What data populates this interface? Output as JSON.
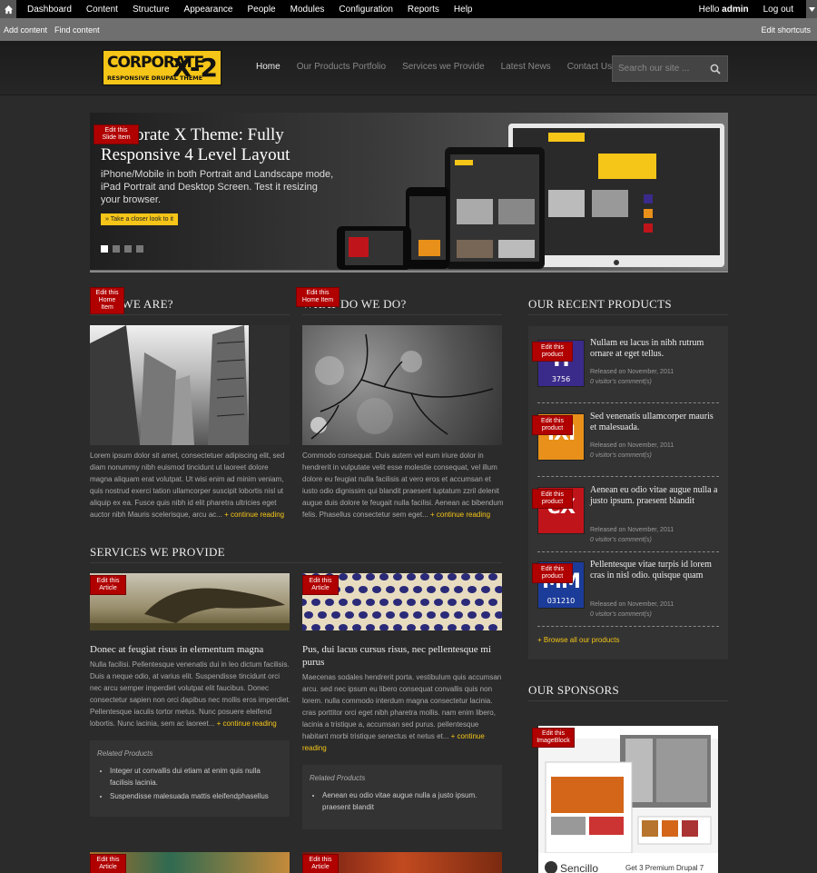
{
  "toolbar": {
    "menu": [
      "Dashboard",
      "Content",
      "Structure",
      "Appearance",
      "People",
      "Modules",
      "Configuration",
      "Reports",
      "Help"
    ],
    "hello": "Hello",
    "user": "admin",
    "logout": "Log out"
  },
  "shortcuts": {
    "items": [
      "Add content",
      "Find content"
    ],
    "edit": "Edit shortcuts"
  },
  "logo": {
    "line1": "CORPORATE",
    "line2": "RESPONSIVE DRUPAL THEME",
    "line3": "X-2"
  },
  "nav": [
    "Home",
    "Our Products Portfolio",
    "Services we Provide",
    "Latest News",
    "Contact Us"
  ],
  "search": {
    "placeholder": "Search our site ..."
  },
  "slider": {
    "edit": "Edit this Slide Item",
    "title": "Corporate X Theme: Fully Responsive 4 Level Layout",
    "text": "iPhone/Mobile in both Portrait and Landscape mode, iPad Portrait and Desktop Screen. Test it resizing your browser.",
    "button": "» Take a closer look to it",
    "slides": 4,
    "active_slide": 1
  },
  "who": {
    "edit": "Edit this Home Item",
    "title": "WHO WE ARE?",
    "text": "Lorem ipsum dolor sit amet, consectetuer adipiscing elit, sed diam nonummy nibh euismod tincidunt ut laoreet dolore magna aliquam erat volutpat. Ut wisi enim ad minim veniam, quis nostrud exerci tation ullamcorper suscipit lobortis nisl ut aliquip ex ea. Fusce quis nibh id elit pharetra ultricies eget auctor nibh Mauris scelerisque, arcu ac...",
    "more": "+ continue reading"
  },
  "what": {
    "edit": "Edit this Home Item",
    "title": "WHAT DO WE DO?",
    "text": "Commodo consequat. Duis autem vel eum iriure dolor in hendrerit in vulputate velit esse molestie consequat, vel illum dolore eu feugiat nulla facilisis at vero eros et accumsan et iusto odio dignissim qui blandit praesent luptatum zzril delenit augue duis dolore te feugait nulla facilisi. Aenean ac bibendum felis. Phasellus consectetur sem eget...",
    "more": "+ continue reading"
  },
  "services": {
    "title": "SERVICES WE PROVIDE",
    "articles": [
      {
        "edit": "Edit this Article",
        "title": "Donec at feugiat risus in elementum magna",
        "text": "Nulla facilisi. Pellentesque venenatis dui in leo dictum facilisis. Duis a neque odio, at varius elit. Suspendisse tincidunt orci nec arcu semper imperdiet volutpat elit faucibus. Donec consectetur sapien non orci dapibus nec mollis eros imperdiet. Pellentesque iaculis tortor metus. Nunc posuere eleifend lobortis. Nunc lacinia, sem ac laoreet...",
        "more": "+ continue reading",
        "related_title": "Related Products",
        "related": [
          "Integer ut convallis dui etiam at enim quis nulla facilisis lacinia.",
          "Suspendisse malesuada mattis eleifendphasellus"
        ]
      },
      {
        "edit": "Edit this Article",
        "title": "Pus, dui lacus cursus risus, nec pellentesque mi purus",
        "text": "Maecenas sodales hendrerit porta. vestibulum quis accumsan arcu. sed nec ipsum eu libero consequat convallis quis non lorem. nulla commodo interdum magna consectetur lacinia. cras porttitor orci eget nibh pharetra mollis. nam enim libero, lacinia a tristique a, accumsan sed purus. pellentesque habitant morbi tristique senectus et netus et...",
        "more": "+ continue reading",
        "related_title": "Related Products",
        "related": [
          "Aenean eu odio vitae augue nulla a justo ipsum. praesent blandit"
        ]
      }
    ],
    "bottom_edits": [
      "Edit this Article",
      "Edit this Article"
    ]
  },
  "recent": {
    "title": "OUR RECENT PRODUCTS",
    "items": [
      {
        "edit": "Edit this product",
        "title": "Nullam eu lacus in nibh rutrum ornare at eget tellus.",
        "released": "Released on November, 2011",
        "comments": "0 visitor's comment(s)",
        "thumb_color": "#3a2a8a",
        "glyph": "H",
        "glyph_sub": "3756"
      },
      {
        "edit": "Edit this product",
        "title": "Sed venenatis ullamcorper mauris et malesuada.",
        "released": "Released on November, 2011",
        "comments": "0 visitor's comment(s)",
        "thumb_color": "#e8901a",
        "glyph": "IXI",
        "glyph_sub": ""
      },
      {
        "edit": "Edit this product",
        "title": "Aenean eu odio vitae augue nulla a justo ipsum. praesent blandit",
        "released": "Released on November, 2011",
        "comments": "0 visitor's comment(s)",
        "thumb_color": "#c0141b",
        "glyph": "eX",
        "glyph_sub": ""
      },
      {
        "edit": "Edit this product",
        "title": "Pellentesque vitae turpis id lorem cras in nisl odio. quisque quam",
        "released": "Released on November, 2011",
        "comments": "0 visitor's comment(s)",
        "thumb_color": "#1c3c9a",
        "glyph": "MM",
        "glyph_sub": "031210"
      }
    ],
    "browse": "+ Browse all our products"
  },
  "sponsors": {
    "title": "OUR SPONSORS",
    "edit": "Edit this ImageBlock",
    "brand": "Sencillo",
    "caption": "Get 3 Premium Drupal 7"
  },
  "colors": {
    "accent": "#f5c518",
    "edit_badge": "#b00000",
    "background": "#2b2b2b"
  }
}
